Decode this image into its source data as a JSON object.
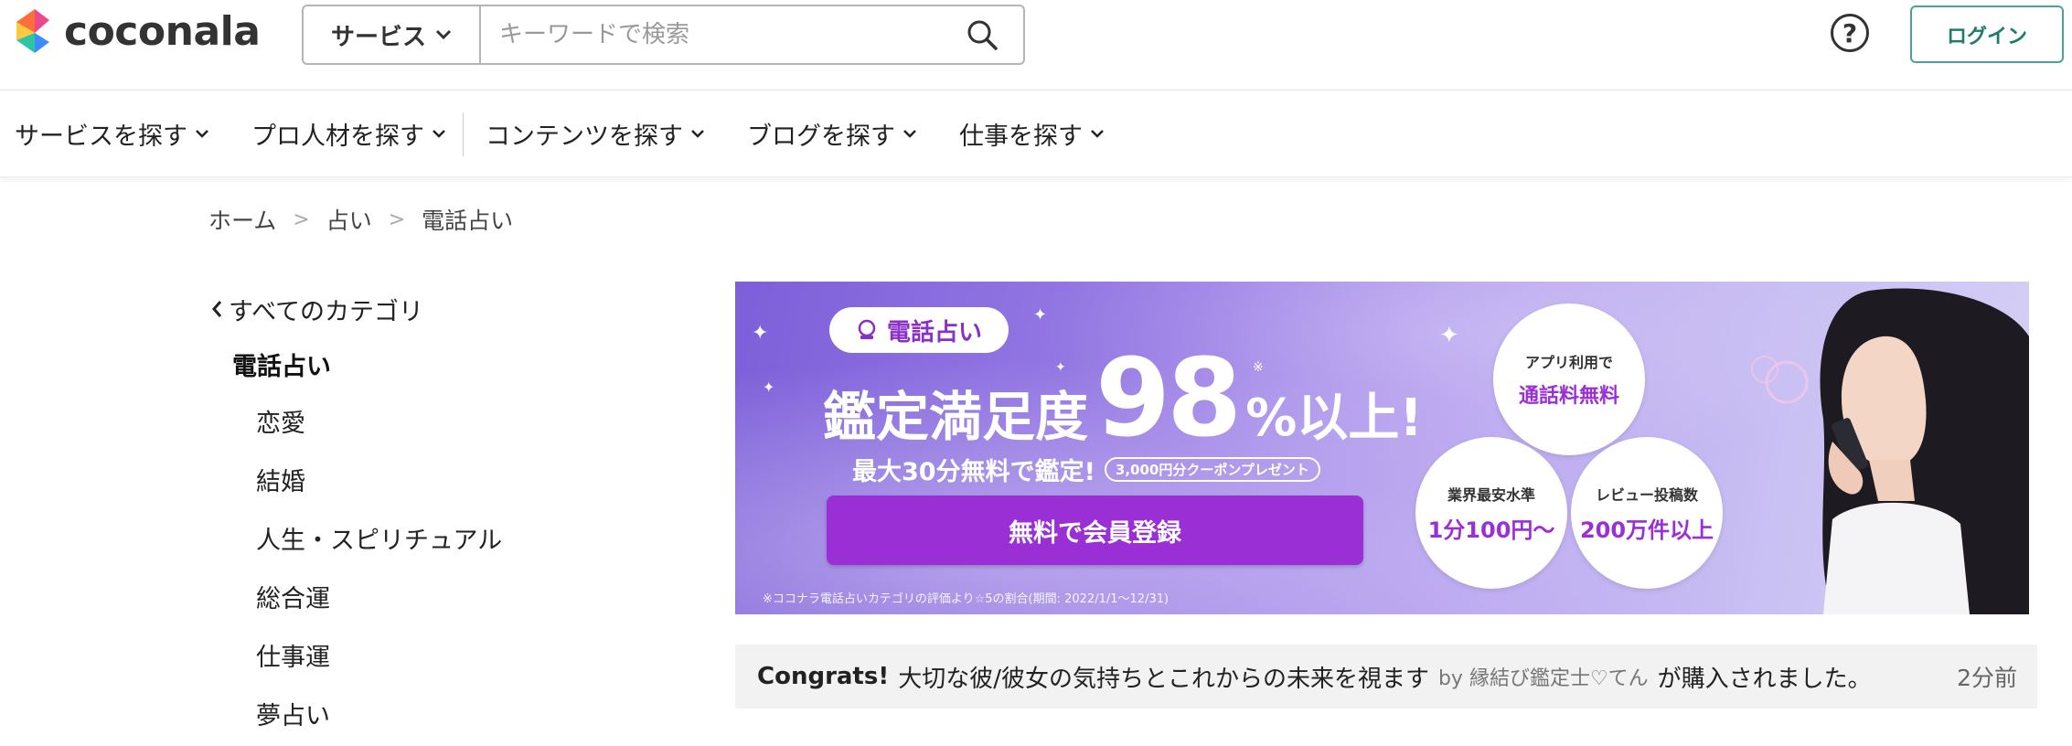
{
  "header": {
    "logo_text": "coconala",
    "search": {
      "category_label": "サービス",
      "placeholder": "キーワードで検索"
    },
    "help_label": "?",
    "login_label": "ログイン"
  },
  "nav": {
    "items": [
      {
        "label": "サービスを探す"
      },
      {
        "label": "プロ人材を探す"
      },
      {
        "label": "コンテンツを探す"
      },
      {
        "label": "ブログを探す"
      },
      {
        "label": "仕事を探す"
      }
    ]
  },
  "breadcrumb": {
    "items": [
      "ホーム",
      "占い",
      "電話占い"
    ],
    "separator": ">"
  },
  "sidebar": {
    "back_label": "すべてのカテゴリ",
    "current": "電話占い",
    "items": [
      "恋愛",
      "結婚",
      "人生・スピリチュアル",
      "総合運",
      "仕事運",
      "夢占い"
    ]
  },
  "banner": {
    "badge": "電話占い",
    "headline_a": "鑑定満足度",
    "headline_num": "98",
    "headline_b": "%以上!",
    "asterisk": "※",
    "subline": "最大30分無料で鑑定!",
    "coupon": "3,000円分クーポンプレゼント",
    "cta": "無料で会員登録",
    "note": "※ココナラ電話占いカテゴリの評価より☆5の割合(期間: 2022/1/1〜12/31)",
    "circles": [
      {
        "small": "アプリ利用で",
        "big": "通話料無料"
      },
      {
        "small": "業界最安水準",
        "big": "1分100円〜"
      },
      {
        "small": "レビュー投稿数",
        "big": "200万件以上"
      }
    ]
  },
  "congrats": {
    "title": "Congrats!",
    "text": "大切な彼/彼女の気持ちとこれからの未来を視ます",
    "by": "by 縁結び鑑定士♡てん",
    "suffix": "が購入されました。",
    "time": "2分前"
  },
  "colors": {
    "accent_purple": "#9b2fd6",
    "login_green": "#1f7a68",
    "banner_bg": "#9b7fe6"
  }
}
